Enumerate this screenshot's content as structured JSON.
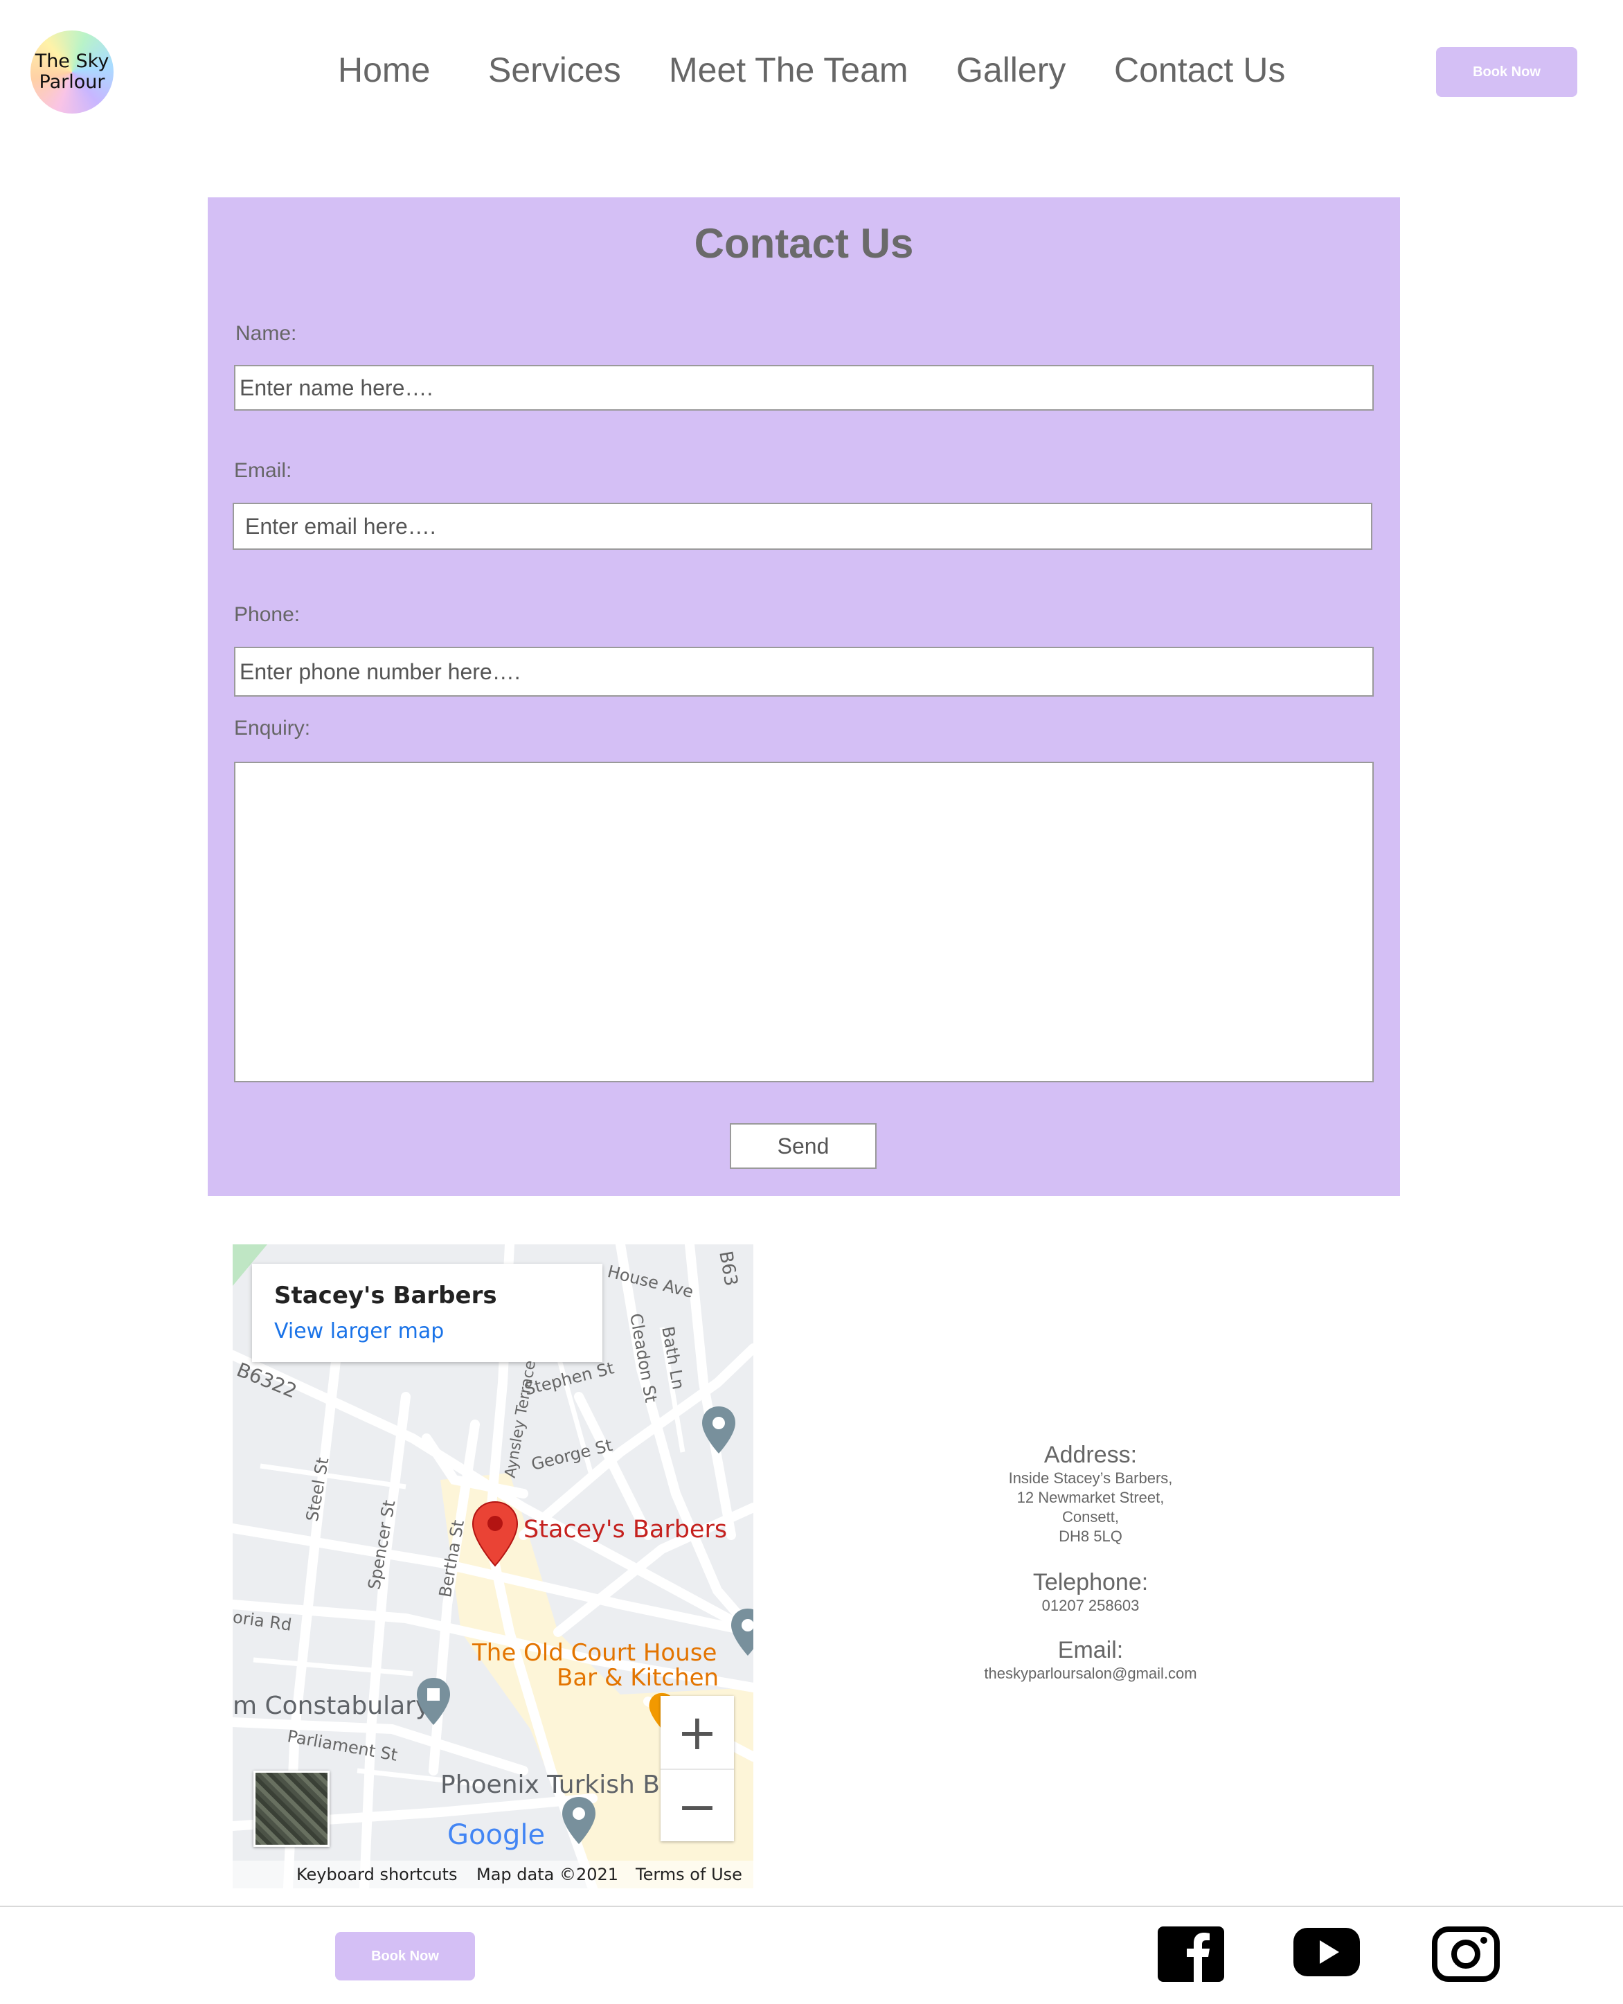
{
  "brand": {
    "line1": "The Sky",
    "line2": "Parlour"
  },
  "nav": {
    "items": [
      "Home",
      "Services",
      "Meet The Team",
      "Gallery",
      "Contact Us"
    ]
  },
  "header": {
    "book_label": "Book Now"
  },
  "form": {
    "title": "Contact Us",
    "name_label": "Name:",
    "name_placeholder": "Enter name here….",
    "email_label": "Email:",
    "email_placeholder": "Enter email here….",
    "phone_label": "Phone:",
    "phone_placeholder": "Enter phone number here….",
    "enquiry_label": "Enquiry:",
    "enquiry_value": "",
    "send_label": "Send"
  },
  "map": {
    "place_title": "Stacey's Barbers",
    "larger_map_link": "View larger map",
    "pin_label": "Stacey's Barbers",
    "poi_1_line1": "The Old Court House",
    "poi_1_line2": "Bar & Kitchen",
    "poi_2": "m Constabulary",
    "poi_3": "Phoenix Turkish Ba",
    "streets": {
      "house_ave": "House Ave",
      "b63": "B63",
      "b6322": "B6322",
      "stephen": "Stephen St",
      "consett_edge": "Cleadon St",
      "bath": "Bath Ln",
      "aynsley": "Aynsley Terrace",
      "george": "George St",
      "steel": "Steel St",
      "spencer": "Spencer St",
      "bertha": "Bertha St",
      "victoria": "oria Rd",
      "parliament": "Parliament St"
    },
    "zoom_in": "+",
    "zoom_out": "−",
    "google": "Google",
    "attribution": {
      "shortcuts": "Keyboard shortcuts",
      "data": "Map data ©2021",
      "terms": "Terms of Use"
    }
  },
  "contact": {
    "address_label": "Address:",
    "address_lines": [
      "Inside Stacey’s Barbers,",
      "12 Newmarket Street,",
      "Consett,",
      "DH8 5LQ"
    ],
    "telephone_label": "Telephone:",
    "telephone": "01207 258603",
    "email_label": "Email:",
    "email": "theskyparloursalon@gmail.com"
  },
  "footer": {
    "book_label": "Book Now",
    "social": [
      "facebook-icon",
      "youtube-icon",
      "instagram-icon"
    ]
  },
  "colors": {
    "accent": "#d4bff5",
    "text": "#666666"
  }
}
